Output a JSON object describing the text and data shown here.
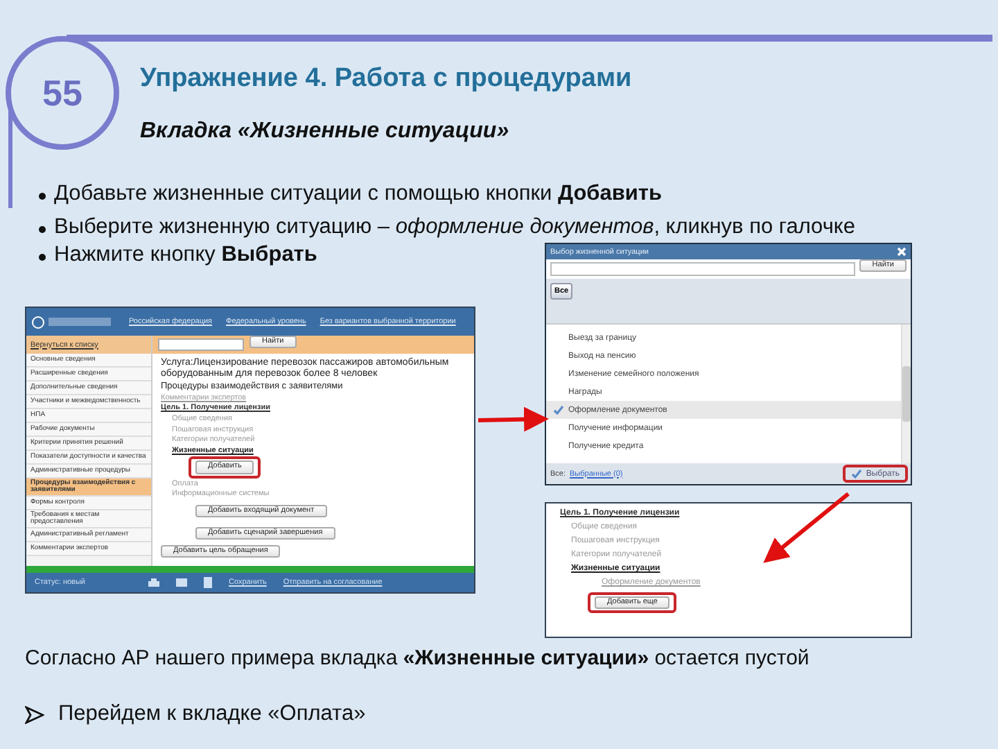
{
  "slide_number": "55",
  "title": "Упражнение 4. Работа с процедурами",
  "subtitle": "Вкладка «Жизненные ситуации»",
  "bullets": [
    "Добавьте жизненные ситуации с помощью кнопки **Добавить**",
    "Выберите жизненную ситуацию – *оформление документов*, кликнув по галочке",
    "Нажмите кнопку **Выбрать**"
  ],
  "portal": {
    "header_links": [
      "Российская федерация",
      "Федеральный уровень",
      "Без вариантов выбранной территории"
    ],
    "back_link": "Вернуться к списку",
    "sidebar": [
      {
        "label": "Основные сведения",
        "selected": false
      },
      {
        "label": "Расширенные сведения",
        "selected": false
      },
      {
        "label": "Дополнительные сведения",
        "selected": false
      },
      {
        "label": "Участники и межведомственность",
        "selected": false
      },
      {
        "label": "НПА",
        "selected": false
      },
      {
        "label": "Рабочие документы",
        "selected": false
      },
      {
        "label": "Критерии принятия решений",
        "selected": false
      },
      {
        "label": "Показатели доступности и качества",
        "selected": false
      },
      {
        "label": "Административные процедуры",
        "selected": false
      },
      {
        "label": "Процедуры взаимодействия с заявителями",
        "selected": true
      },
      {
        "label": "Формы контроля",
        "selected": false
      },
      {
        "label": "Требования к местам предоставления",
        "selected": false
      },
      {
        "label": "Административный регламент",
        "selected": false
      },
      {
        "label": "Комментарии экспертов",
        "selected": false
      }
    ],
    "search_button": "Найти",
    "service_title": "Услуга:Лицензирование перевозок пассажиров автомобильным оборудованным для перевозок более 8 человек",
    "section_title": "Процедуры взаимодействия с заявителями",
    "main": [
      {
        "kind": "link",
        "label": "Комментарии экспертов"
      },
      {
        "kind": "goal",
        "label": "Цель 1. Получение лицензии"
      },
      {
        "kind": "sublink",
        "label": "Общие сведения"
      },
      {
        "kind": "sublink",
        "label": "Пошаговая инструкция"
      },
      {
        "kind": "sublink",
        "label": "Категории получателей"
      },
      {
        "kind": "heading",
        "label": "Жизненные ситуации"
      },
      {
        "kind": "button",
        "label": "Добавить",
        "highlighted": true
      },
      {
        "kind": "sublink",
        "label": "Оплата"
      },
      {
        "kind": "sublink",
        "label": "Информационные системы"
      },
      {
        "kind": "button",
        "label": "Добавить входящий документ",
        "highlighted": false
      },
      {
        "kind": "button",
        "label": "Добавить сценарий завершения",
        "highlighted": false
      },
      {
        "kind": "goal-button",
        "label": "Добавить цель обращения"
      }
    ],
    "status": "Статус: новый",
    "actions": [
      "Сохранить",
      "Отправить на согласование"
    ]
  },
  "dialog": {
    "title": "Выбор жизненной ситуации",
    "search_button": "Найти",
    "filter_button": "Все",
    "items": [
      {
        "label": "Выезд за границу",
        "selected": false
      },
      {
        "label": "Выход на пенсию",
        "selected": false
      },
      {
        "label": "Изменение семейного положения",
        "selected": false
      },
      {
        "label": "Награды",
        "selected": false
      },
      {
        "label": "Оформление документов",
        "selected": true
      },
      {
        "label": "Получение информации",
        "selected": false
      },
      {
        "label": "Получение кредита",
        "selected": false
      }
    ],
    "footer_label": "Все:",
    "footer_link": "Выбранные (0)",
    "select_button": {
      "label": "Выбрать",
      "highlighted": true
    }
  },
  "result": {
    "items": [
      {
        "kind": "goal",
        "label": "Цель 1. Получение лицензии"
      },
      {
        "kind": "sublink",
        "label": "Общие сведения"
      },
      {
        "kind": "sublink",
        "label": "Пошаговая инструкция"
      },
      {
        "kind": "sublink",
        "label": "Категории получателей"
      },
      {
        "kind": "heading",
        "label": "Жизненные ситуации"
      },
      {
        "kind": "entry",
        "label": "Оформление документов"
      },
      {
        "kind": "button",
        "label": "Добавить еще",
        "highlighted": true
      }
    ]
  },
  "note": "Согласно АР нашего примера вкладка **«Жизненные ситуации»** остается пустой",
  "next_step": "Перейдем к вкладке «Оплата»"
}
